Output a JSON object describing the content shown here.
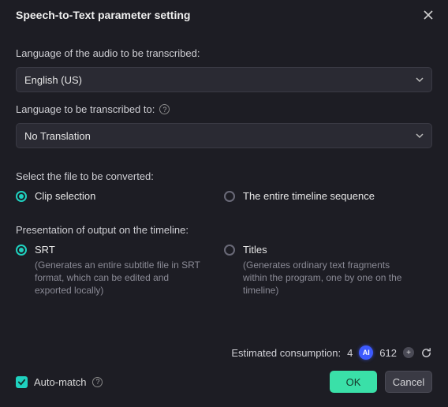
{
  "title": "Speech-to-Text parameter setting",
  "labels": {
    "source_language": "Language of the audio to be transcribed:",
    "target_language": "Language to be transcribed to:",
    "file_select": "Select the file to be converted:",
    "presentation": "Presentation of output on the timeline:"
  },
  "selects": {
    "source_language_value": "English (US)",
    "target_language_value": "No Translation"
  },
  "file_options": {
    "clip": "Clip selection",
    "timeline": "The entire timeline sequence"
  },
  "output_options": {
    "srt": {
      "label": "SRT",
      "desc": "(Generates an entire subtitle file in SRT format, which can be edited and exported locally)"
    },
    "titles": {
      "label": "Titles",
      "desc": "(Generates ordinary text fragments within the program, one by one on the timeline)"
    }
  },
  "footer": {
    "estimated_label": "Estimated consumption:",
    "estimated_value": "4",
    "ai_badge": "AI",
    "credits": "612",
    "automatch": "Auto-match",
    "ok": "OK",
    "cancel": "Cancel"
  },
  "help_glyph": "?"
}
